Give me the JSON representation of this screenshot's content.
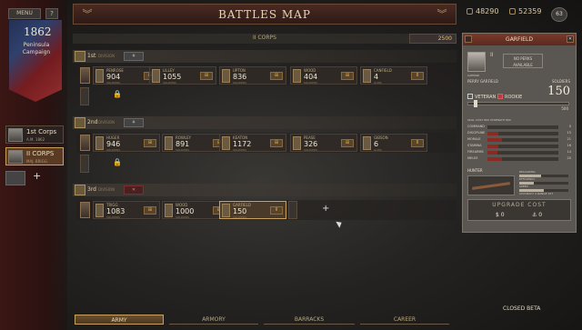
{
  "header": {
    "title": "BATTLES MAP",
    "menu_label": "MENU",
    "help_label": "?",
    "silver": "48290",
    "gold": "52359",
    "level": "63"
  },
  "campaign": {
    "year": "1862",
    "name_line1": "Peninsula",
    "name_line2": "Campaign"
  },
  "corps_list": [
    {
      "name": "1st Corps",
      "sub": "A.M. 1862"
    },
    {
      "name": "II CORPS",
      "sub": "MAJ. BRIGG."
    }
  ],
  "corps_header": {
    "title": "II CORPS",
    "points": "2500"
  },
  "divisions": [
    {
      "num": "1st",
      "label": "DIVISION",
      "badge": "⚘",
      "badge_style": "normal",
      "units": [
        {
          "name": "PENROSE",
          "value": "904",
          "sub": "SOLDIERS",
          "btn": "⊞"
        },
        {
          "name": "LILLEY",
          "value": "1055",
          "sub": "SOLDIERS",
          "btn": "⊞"
        },
        {
          "name": "UPTON",
          "value": "836",
          "sub": "SOLDIERS",
          "btn": "⊞"
        },
        {
          "name": "WOOD",
          "value": "404",
          "sub": "SOLDIERS",
          "btn": "⊞"
        },
        {
          "name": "CANFIELD",
          "value": "4",
          "sub": "GUNS",
          "btn": "II"
        }
      ]
    },
    {
      "num": "2nd",
      "label": "DIVISION",
      "badge": "⚘",
      "badge_style": "normal",
      "units": [
        {
          "name": "HUGER",
          "value": "946",
          "sub": "SOLDIERS",
          "btn": "⊞"
        },
        {
          "name": "ROWLEY",
          "value": "891",
          "sub": "SOLDIERS",
          "btn": "⊞"
        },
        {
          "name": "KEATON",
          "value": "1172",
          "sub": "SOLDIERS",
          "btn": "⊞"
        },
        {
          "name": "PEASE",
          "value": "326",
          "sub": "SOLDIERS",
          "btn": "⊞"
        },
        {
          "name": "GIBSON",
          "value": "6",
          "sub": "GUNS",
          "btn": "II"
        }
      ]
    },
    {
      "num": "3rd",
      "label": "DIVISION",
      "badge": "✕",
      "badge_style": "red",
      "units": [
        {
          "name": "TRIGG",
          "value": "1083",
          "sub": "SOLDIERS",
          "btn": "⊞"
        },
        {
          "name": "WOOD",
          "value": "1000",
          "sub": "SOLDIERS",
          "btn": "⊞"
        },
        {
          "name": "GARFIELD",
          "value": "150",
          "sub": "SOLDIERS",
          "btn": "II"
        }
      ]
    }
  ],
  "detail": {
    "title": "GARFIELD",
    "close": "✕",
    "rank": "CAPTAIN",
    "rank_badge": "II",
    "avail_line1": "NO PERKS",
    "avail_line2": "AVAILABLE",
    "officer": "PERRY GARFIELD",
    "soldiers_label": "SOLDIERS",
    "soldiers": "150",
    "veteran": "VETERAN",
    "rookie": "ROOKIE",
    "max": "500",
    "skills_head": "SKILL COST   800   STRENGTH   800",
    "stats": [
      {
        "label": "COMMAND",
        "value": "0",
        "fill": 0.0
      },
      {
        "label": "DISCIPLINE",
        "value": "15",
        "fill": 0.15
      },
      {
        "label": "MORALE",
        "value": "21",
        "fill": 0.21
      },
      {
        "label": "STAMINA",
        "value": "16",
        "fill": 0.16
      },
      {
        "label": "FIREARMS",
        "value": "14",
        "fill": 0.14
      },
      {
        "label": "MELEE",
        "value": "20",
        "fill": 0.2
      }
    ],
    "weapon_label": "HUNTER",
    "weapon_stats": [
      {
        "label": "RELOADING",
        "fill": 0.45
      },
      {
        "label": "EFFICIENCY",
        "fill": 0.3
      },
      {
        "label": "SPEED",
        "fill": 0.5
      },
      {
        "label": "ACCURACY   4     RANGE   157",
        "fill": 0.6
      }
    ],
    "upgrade_title": "UPGRADE COST",
    "upgrade_silver": "$ 0",
    "upgrade_gold": "⚓ 0"
  },
  "bottom_tabs": [
    "ARMY",
    "ARMORY",
    "BARRACKS",
    "CAREER"
  ],
  "beta": "CLOSED BETA"
}
